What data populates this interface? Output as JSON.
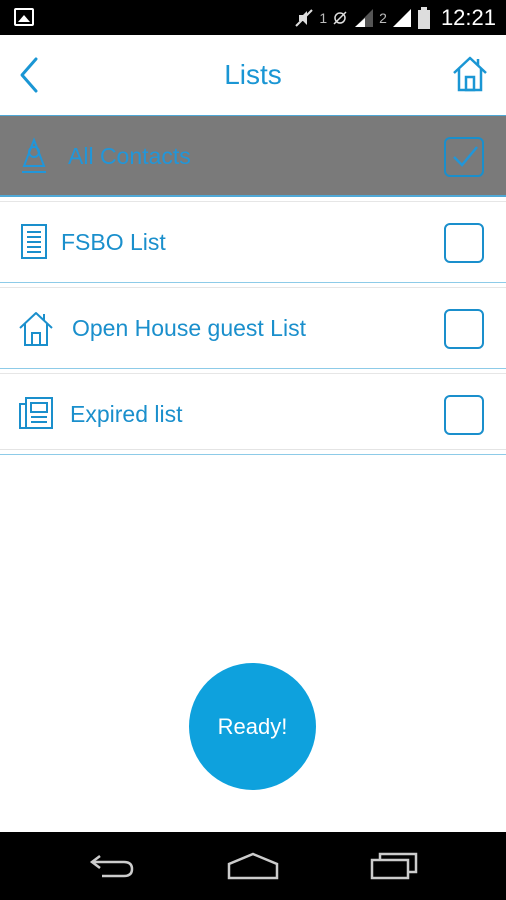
{
  "status_bar": {
    "sim1": "1",
    "sim2": "2",
    "time": "12:21"
  },
  "header": {
    "title": "Lists"
  },
  "lists": [
    {
      "label": "All Contacts",
      "icon": "contacts-icon",
      "checked": true
    },
    {
      "label": "FSBO List",
      "icon": "document-icon",
      "checked": false
    },
    {
      "label": "Open House guest List",
      "icon": "house-icon",
      "checked": false
    },
    {
      "label": "Expired list",
      "icon": "newspaper-icon",
      "checked": false
    }
  ],
  "ready_button": {
    "label": "Ready!"
  },
  "colors": {
    "accent": "#1a96d4",
    "ready_bg": "#0ea1dd",
    "selected_row_bg": "#7a7a7a"
  }
}
